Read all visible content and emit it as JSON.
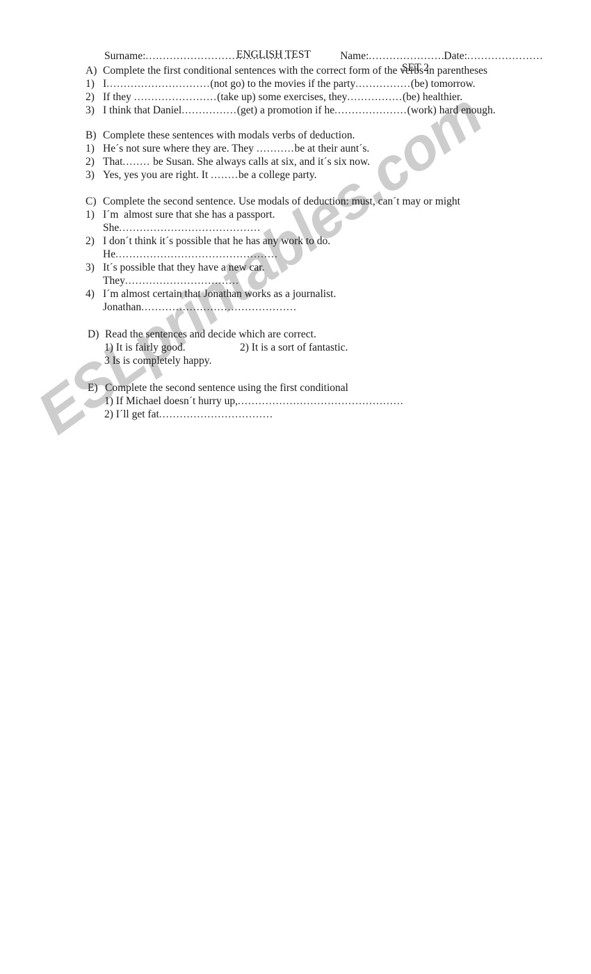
{
  "document": {
    "title": "ENGLISH TEST",
    "set_label": "SET 2",
    "header_fields": {
      "surname_label": "Surname:",
      "surname_dots": "...........................................",
      "name_label": "Name:",
      "name_dots": "..............................",
      "date_label": "Date:",
      "date_dots": "..........................."
    },
    "watermark": "ESLprintables.com",
    "colors": {
      "page_background": "#ffffff",
      "text": "#1a1a1a",
      "watermark": "#cdcdcd"
    }
  },
  "sections": {
    "a": {
      "marker": "A)",
      "instruction": "Complete the first conditional sentences with the correct form of the verbs in parentheses",
      "items": [
        {
          "marker": "1)",
          "pre": "I",
          "dots1": "..............................",
          "mid": "(not go) to the movies if the party",
          "dots2": "................",
          "post": "(be) tomorrow."
        },
        {
          "marker": "2)",
          "pre": "If they ",
          "dots1": "........................",
          "mid": "(take up) some exercises, they",
          "dots2": "................",
          "post": "(be) healthier."
        },
        {
          "marker": "3)",
          "pre": "I think that Daniel",
          "dots1": "................",
          "mid": "(get) a promotion if he",
          "dots2": ".....................",
          "post": "(work) hard enough."
        }
      ]
    },
    "b": {
      "marker": "B)",
      "instruction": "Complete these sentences with modals verbs of deduction.",
      "items": [
        {
          "marker": "1)",
          "pre": "He´s not sure where they are. They ",
          "dots1": "...........",
          "post": "be at their aunt´s."
        },
        {
          "marker": "2)",
          "pre": "That",
          "dots1": "........",
          "post": " be Susan. She always calls at six, and it´s six now."
        },
        {
          "marker": "3)",
          "pre": "Yes, yes you are right. It ",
          "dots1": "........",
          "post": "be a college party."
        }
      ]
    },
    "c": {
      "marker": "C)",
      "instruction": "Complete the second sentence. Use modals of deduction: must, can´t may or might",
      "items": [
        {
          "marker": "1)",
          "prompt": "I´m  almost sure that she has a passport.",
          "answer_lead": "She",
          "answer_dots": "........................................."
        },
        {
          "marker": "2)",
          "prompt": "I don´t think it´s possible that he has any work to do.",
          "answer_lead": "He",
          "answer_dots": "..............................................."
        },
        {
          "marker": "3)",
          "prompt": "It´s possible that they have a new car.",
          "answer_lead": "They",
          "answer_dots": "................................."
        },
        {
          "marker": "4)",
          "prompt": "I´m almost certain that Jonathan works as a journalist.",
          "answer_lead": "Jonathan",
          "answer_dots": "............................................."
        }
      ]
    },
    "d": {
      "marker": "D)",
      "instruction": "Read the sentences and decide which are correct.",
      "items": [
        {
          "text": "1) It is fairly good."
        },
        {
          "text": "2) It is a sort of fantastic."
        },
        {
          "text": "3 Is is completely happy."
        }
      ]
    },
    "e": {
      "marker": "E)",
      "instruction": "Complete the second sentence using the first conditional",
      "items": [
        {
          "pre": "1) If Michael doesn´t hurry up,",
          "dots": "................................................"
        },
        {
          "pre": "2) I´ll get fat",
          "dots": "................................."
        }
      ]
    }
  }
}
